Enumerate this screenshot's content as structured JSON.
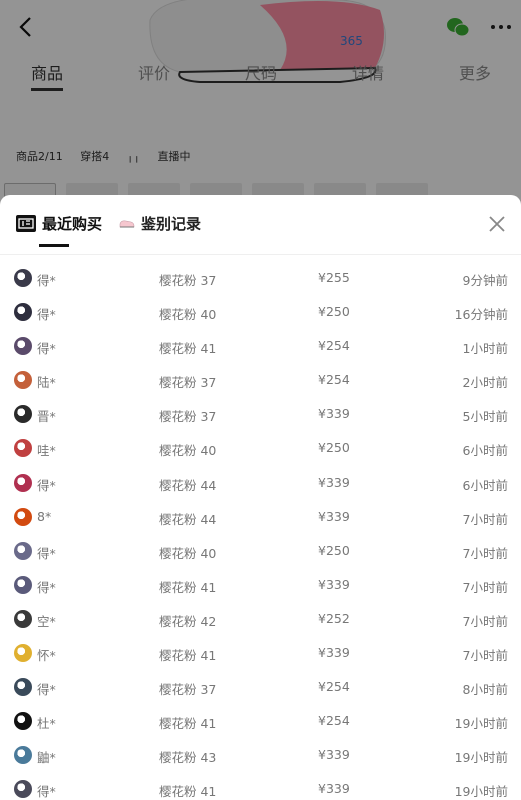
{
  "background": {
    "tabs": [
      "商品",
      "评价",
      "尺码",
      "详情",
      "更多"
    ],
    "meta": [
      "商品2/11",
      "穿搭4",
      "直播中"
    ]
  },
  "sheet": {
    "tab_recent": "最近购买",
    "tab_auth": "鉴别记录",
    "logo_text": "得物",
    "accent": "#111111"
  },
  "purchases": [
    {
      "name": "得*",
      "size": "樱花粉 37",
      "price": "¥255",
      "time": "9分钟前",
      "avatar_color": "#3a3a4a"
    },
    {
      "name": "得*",
      "size": "樱花粉 40",
      "price": "¥250",
      "time": "16分钟前",
      "avatar_color": "#2e2e3e"
    },
    {
      "name": "得*",
      "size": "樱花粉 41",
      "price": "¥254",
      "time": "1小时前",
      "avatar_color": "#5a4a6a"
    },
    {
      "name": "陆*",
      "size": "樱花粉 37",
      "price": "¥254",
      "time": "2小时前",
      "avatar_color": "#c4603a"
    },
    {
      "name": "晋*",
      "size": "樱花粉 37",
      "price": "¥339",
      "time": "5小时前",
      "avatar_color": "#2a2a2a"
    },
    {
      "name": "哇*",
      "size": "樱花粉 40",
      "price": "¥250",
      "time": "6小时前",
      "avatar_color": "#c04040"
    },
    {
      "name": "得*",
      "size": "樱花粉 44",
      "price": "¥339",
      "time": "6小时前",
      "avatar_color": "#b03050"
    },
    {
      "name": "8*",
      "size": "樱花粉 44",
      "price": "¥339",
      "time": "7小时前",
      "avatar_color": "#d24a10"
    },
    {
      "name": "得*",
      "size": "樱花粉 40",
      "price": "¥250",
      "time": "7小时前",
      "avatar_color": "#6a6a8a"
    },
    {
      "name": "得*",
      "size": "樱花粉 41",
      "price": "¥339",
      "time": "7小时前",
      "avatar_color": "#5a5a7a"
    },
    {
      "name": "空*",
      "size": "樱花粉 42",
      "price": "¥252",
      "time": "7小时前",
      "avatar_color": "#3a3a3a"
    },
    {
      "name": "怀*",
      "size": "樱花粉 41",
      "price": "¥339",
      "time": "7小时前",
      "avatar_color": "#e0b030"
    },
    {
      "name": "得*",
      "size": "樱花粉 37",
      "price": "¥254",
      "time": "8小时前",
      "avatar_color": "#3a4a5a"
    },
    {
      "name": "杜*",
      "size": "樱花粉 41",
      "price": "¥254",
      "time": "19小时前",
      "avatar_color": "#111111"
    },
    {
      "name": "鼬*",
      "size": "樱花粉 43",
      "price": "¥339",
      "time": "19小时前",
      "avatar_color": "#4a7a9a"
    },
    {
      "name": "得*",
      "size": "樱花粉 41",
      "price": "¥339",
      "time": "19小时前",
      "avatar_color": "#4a4a5a"
    }
  ]
}
